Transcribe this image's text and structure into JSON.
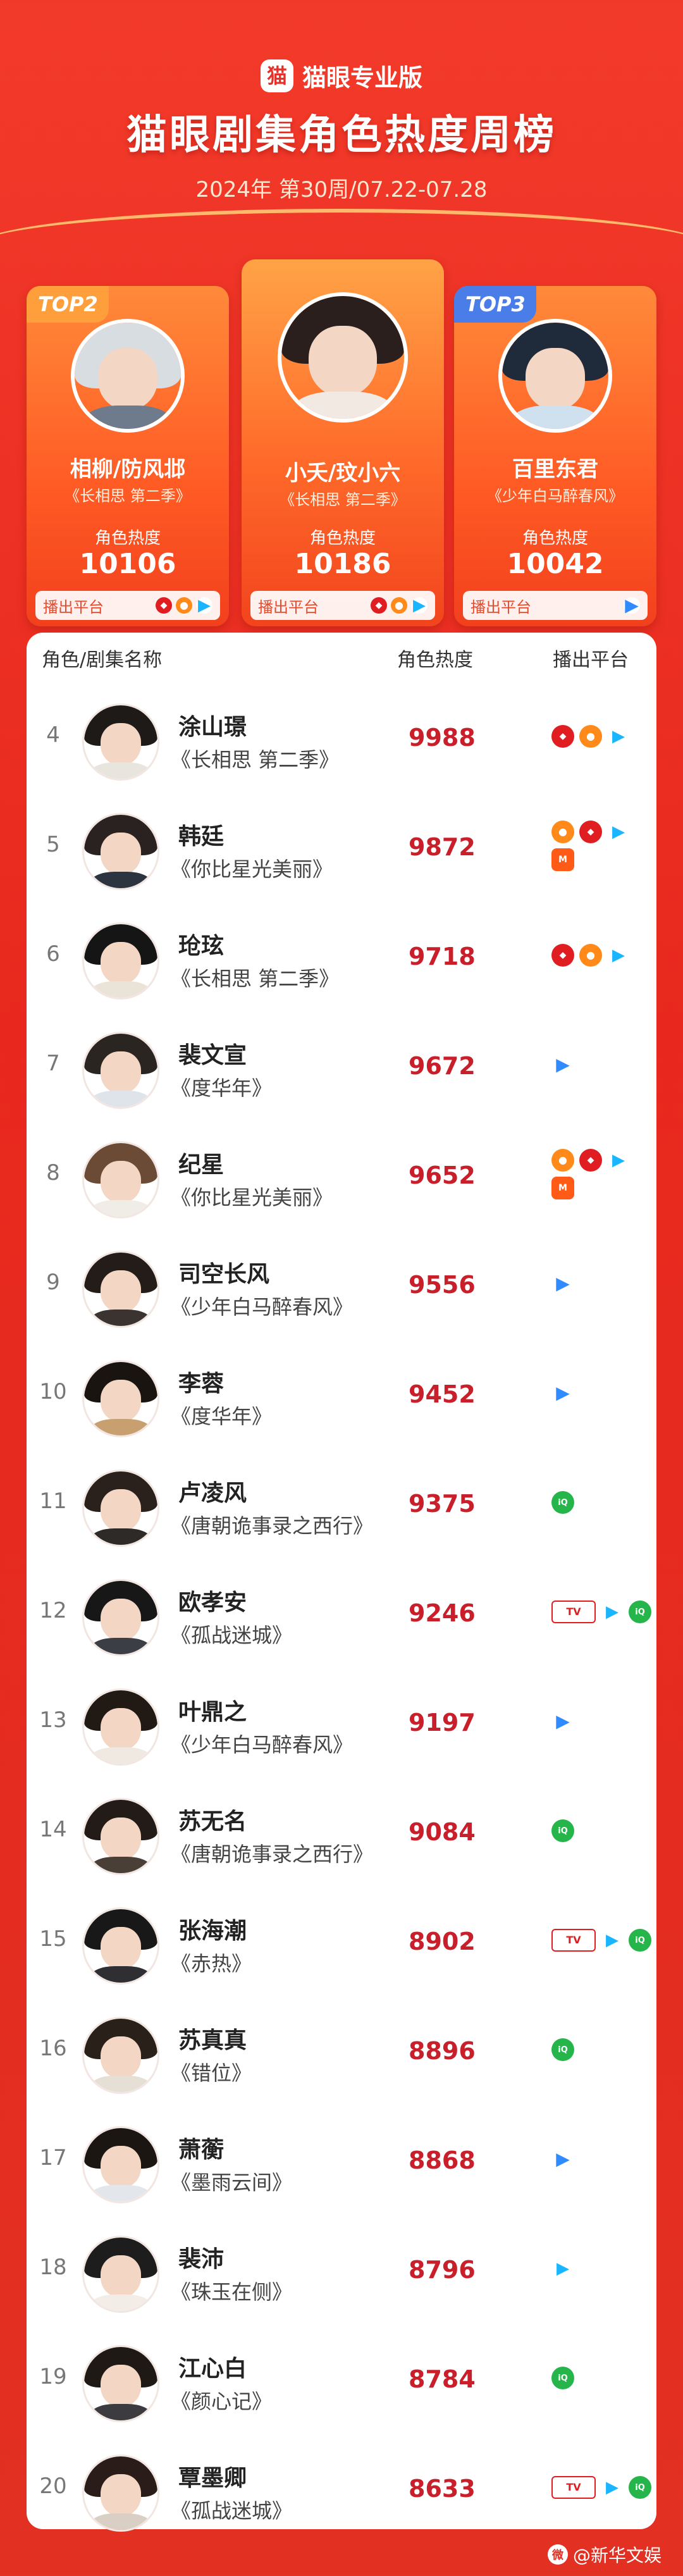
{
  "header": {
    "brand_logo_char": "猫",
    "brand": "猫眼专业版",
    "title": "猫眼剧集角色热度周榜",
    "week": "2024年  第30周/07.22-07.28"
  },
  "top3": {
    "first": {
      "name": "小夭/玟小六",
      "drama": "《长相思 第二季》",
      "heat_label": "角色热度",
      "heat": "10186",
      "platform_label": "播出平台"
    },
    "second": {
      "rank_tag": "TOP2",
      "name": "相柳/防风邶",
      "drama": "《长相思 第二季》",
      "heat_label": "角色热度",
      "heat": "10106",
      "platform_label": "播出平台"
    },
    "third": {
      "rank_tag": "TOP3",
      "name": "百里东君",
      "drama": "《少年白马醉春风》",
      "heat_label": "角色热度",
      "heat": "10042",
      "platform_label": "播出平台"
    }
  },
  "list": {
    "col_name": "角色/剧集名称",
    "col_heat": "角色热度",
    "col_platform": "播出平台",
    "rows": [
      {
        "rank": "4",
        "name": "涂山璟",
        "drama": "《长相思 第二季》",
        "heat": "9988",
        "platforms": [
          "cctv-icon",
          "mango-icon",
          "youku-icon"
        ]
      },
      {
        "rank": "5",
        "name": "韩廷",
        "drama": "《你比星光美丽》",
        "heat": "9872",
        "platforms": [
          "mango-icon",
          "cctv-icon",
          "youku-icon",
          "mgtv-icon"
        ]
      },
      {
        "rank": "6",
        "name": "玱玹",
        "drama": "《长相思 第二季》",
        "heat": "9718",
        "platforms": [
          "cctv-icon",
          "mango-icon",
          "youku-icon"
        ]
      },
      {
        "rank": "7",
        "name": "裴文宣",
        "drama": "《度华年》",
        "heat": "9672",
        "platforms": [
          "tencent-icon"
        ]
      },
      {
        "rank": "8",
        "name": "纪星",
        "drama": "《你比星光美丽》",
        "heat": "9652",
        "platforms": [
          "mango-icon",
          "cctv-icon",
          "youku-icon",
          "mgtv-icon"
        ]
      },
      {
        "rank": "9",
        "name": "司空长风",
        "drama": "《少年白马醉春风》",
        "heat": "9556",
        "platforms": [
          "tencent-icon"
        ]
      },
      {
        "rank": "10",
        "name": "李蓉",
        "drama": "《度华年》",
        "heat": "9452",
        "platforms": [
          "tencent-icon"
        ]
      },
      {
        "rank": "11",
        "name": "卢凌风",
        "drama": "《唐朝诡事录之西行》",
        "heat": "9375",
        "platforms": [
          "iqiyi-icon"
        ]
      },
      {
        "rank": "12",
        "name": "欧孝安",
        "drama": "《孤战迷城》",
        "heat": "9246",
        "platforms": [
          "tv-station-icon",
          "youku-icon",
          "iqiyi-icon"
        ]
      },
      {
        "rank": "13",
        "name": "叶鼎之",
        "drama": "《少年白马醉春风》",
        "heat": "9197",
        "platforms": [
          "tencent-icon"
        ]
      },
      {
        "rank": "14",
        "name": "苏无名",
        "drama": "《唐朝诡事录之西行》",
        "heat": "9084",
        "platforms": [
          "iqiyi-icon"
        ]
      },
      {
        "rank": "15",
        "name": "张海潮",
        "drama": "《赤热》",
        "heat": "8902",
        "platforms": [
          "tv-station-icon",
          "youku-icon",
          "iqiyi-icon"
        ]
      },
      {
        "rank": "16",
        "name": "苏真真",
        "drama": "《错位》",
        "heat": "8896",
        "platforms": [
          "iqiyi-icon"
        ]
      },
      {
        "rank": "17",
        "name": "萧蘅",
        "drama": "《墨雨云间》",
        "heat": "8868",
        "platforms": [
          "tencent-icon"
        ]
      },
      {
        "rank": "18",
        "name": "裴沛",
        "drama": "《珠玉在侧》",
        "heat": "8796",
        "platforms": [
          "youku-icon"
        ]
      },
      {
        "rank": "19",
        "name": "江心白",
        "drama": "《颜心记》",
        "heat": "8784",
        "platforms": [
          "iqiyi-icon"
        ]
      },
      {
        "rank": "20",
        "name": "覃墨卿",
        "drama": "《孤战迷城》",
        "heat": "8633",
        "platforms": [
          "tv-station-icon",
          "youku-icon",
          "iqiyi-icon"
        ]
      }
    ]
  },
  "footer": {
    "credit": "@新华文娱"
  },
  "colors": {
    "background": "#e8281e",
    "heat_text": "#c91f2a",
    "top2_tag": "#ff9f3c",
    "top3_tag": "#4a7de8"
  }
}
